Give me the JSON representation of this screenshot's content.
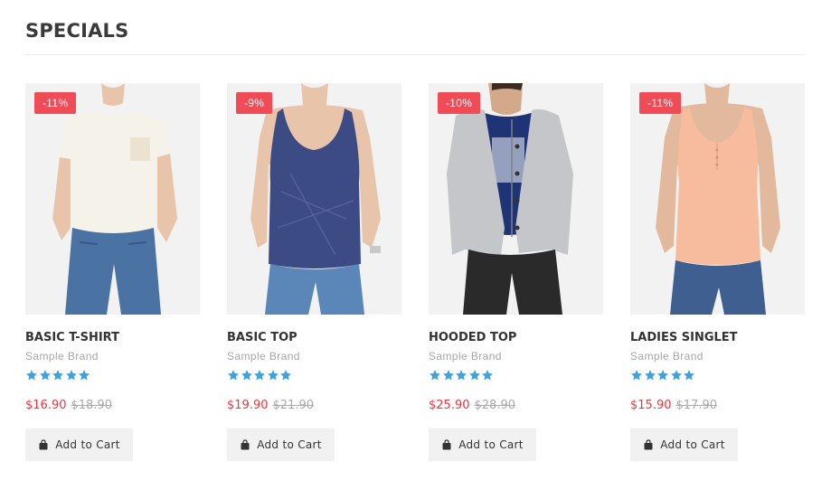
{
  "section": {
    "title": "SPECIALS"
  },
  "colors": {
    "sale_badge": "#ef4c57",
    "star": "#3aa3e3",
    "price_new": "#e8373f",
    "price_old": "#aaaaaa"
  },
  "icons": {
    "cart": "shopping-bag-icon",
    "rating": "star-icon"
  },
  "products": [
    {
      "discount": "-11%",
      "name": "BASIC T-SHIRT",
      "brand": "Sample Brand",
      "rating": 5,
      "price": "$16.90",
      "old_price": "$18.90",
      "cta": "Add to Cart",
      "image": "woman-white-tshirt"
    },
    {
      "discount": "-9%",
      "name": "BASIC TOP",
      "brand": "Sample Brand",
      "rating": 5,
      "price": "$19.90",
      "old_price": "$21.90",
      "cta": "Add to Cart",
      "image": "woman-navy-tank"
    },
    {
      "discount": "-10%",
      "name": "HOODED TOP",
      "brand": "Sample Brand",
      "rating": 5,
      "price": "$25.90",
      "old_price": "$28.90",
      "cta": "Add to Cart",
      "image": "man-grey-hoodie"
    },
    {
      "discount": "-11%",
      "name": "LADIES SINGLET",
      "brand": "Sample Brand",
      "rating": 5,
      "price": "$15.90",
      "old_price": "$17.90",
      "cta": "Add to Cart",
      "image": "woman-peach-singlet"
    }
  ]
}
